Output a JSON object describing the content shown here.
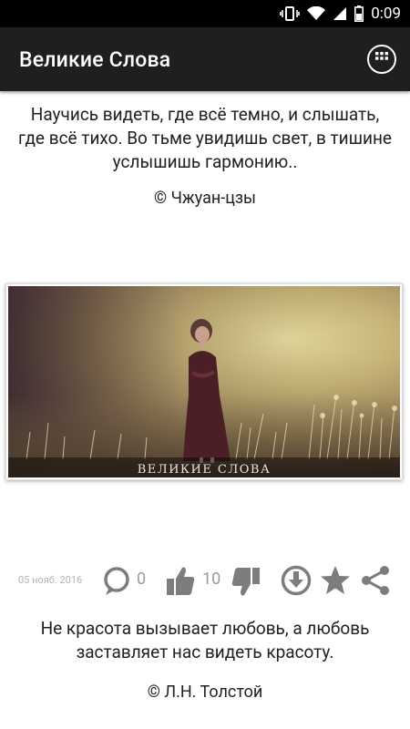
{
  "status_bar": {
    "time": "0:09"
  },
  "app_bar": {
    "title": "Великие Слова"
  },
  "quote1": {
    "lines": [
      "Научись видеть, где всё темно, и слышать,",
      "где всё тихо. Во тьме увидишь свет, в тишине",
      "услышишь гармонию.."
    ],
    "author": "© Чжуан-цзы"
  },
  "image": {
    "watermark": "ВЕЛИКИЕ СЛОВА"
  },
  "actions": {
    "date": "05 нояб. 2016",
    "comments_count": "0",
    "likes_count": "10"
  },
  "quote2": {
    "lines": [
      "Не красота вызывает любовь, а любовь",
      "заставляет нас видеть красоту."
    ],
    "author": "© Л.Н. Толстой"
  },
  "colors": {
    "app_bar": "#1f1f1f",
    "icon_gray": "#7d7d7d",
    "status_bar": "#000000"
  }
}
